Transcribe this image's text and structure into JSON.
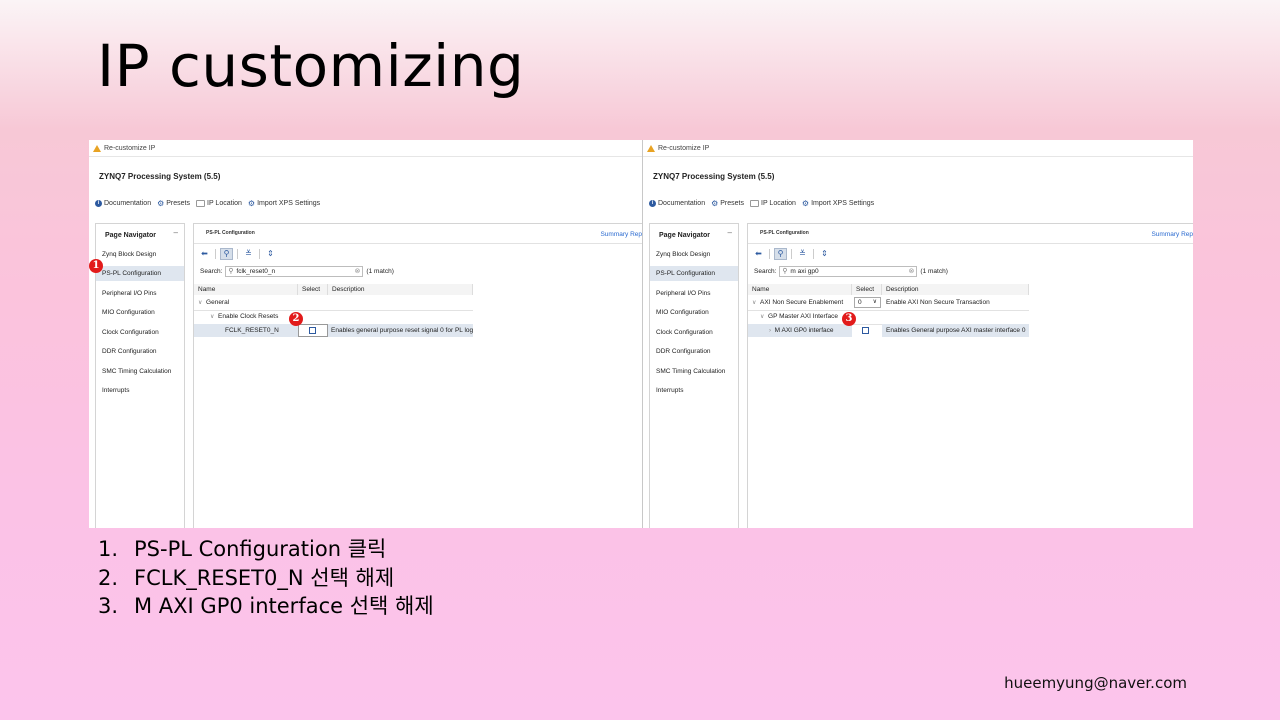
{
  "slide": {
    "title": "IP customizing",
    "steps": [
      {
        "num": "1.",
        "text": "PS-PL Configuration 클릭"
      },
      {
        "num": "2.",
        "text": "FCLK_RESET0_N 선택 해제"
      },
      {
        "num": "3.",
        "text": "M AXI GP0 interface 선택 해제"
      }
    ],
    "email": "hueemyung@naver.com"
  },
  "dialog_common": {
    "window_title": "Re-customize IP",
    "product_title": "ZYNQ7 Processing System (5.5)",
    "toolbar": {
      "documentation": "Documentation",
      "presets": "Presets",
      "ip_location": "IP Location",
      "import_xps": "Import XPS Settings"
    },
    "page_navigator": {
      "header": "Page Navigator",
      "collapse": "–",
      "items": [
        "Zynq Block Design",
        "PS-PL Configuration",
        "Peripheral I/O Pins",
        "MIO Configuration",
        "Clock Configuration",
        "DDR Configuration",
        "SMC Timing Calculation",
        "Interrupts"
      ],
      "selected": "PS-PL Configuration"
    },
    "config_title": "PS-PL Configuration",
    "summary_link": "Summary Rep",
    "search_label": "Search:",
    "columns": {
      "name": "Name",
      "select": "Select",
      "description": "Description"
    }
  },
  "left_panel": {
    "search_value": "fclk_reset0_n",
    "match_count": "(1 match)",
    "rows": {
      "general": "General",
      "enable_clock_resets": "Enable Clock Resets",
      "fclk_reset0_n": "FCLK_RESET0_N",
      "fclk_desc": "Enables general purpose reset signal 0 for PL logi"
    },
    "marker_1": "1",
    "marker_2": "2"
  },
  "right_panel": {
    "search_value": "m axi gp0",
    "match_count": "(1 match)",
    "rows": {
      "axi_non_secure": "AXI Non Secure Enablement",
      "axi_non_secure_value": "0",
      "axi_non_secure_desc": "Enable AXI Non Secure Transaction",
      "gp_master": "GP Master AXI Interface",
      "m_axi_gp0": "M AXI GP0 interface",
      "m_axi_gp0_desc": "Enables General purpose AXI master interface 0"
    },
    "marker_3": "3"
  },
  "colors": {
    "marker_red": "#e21b1b",
    "selection_blue": "#dfe6ef",
    "link_blue": "#2a6ad0"
  }
}
